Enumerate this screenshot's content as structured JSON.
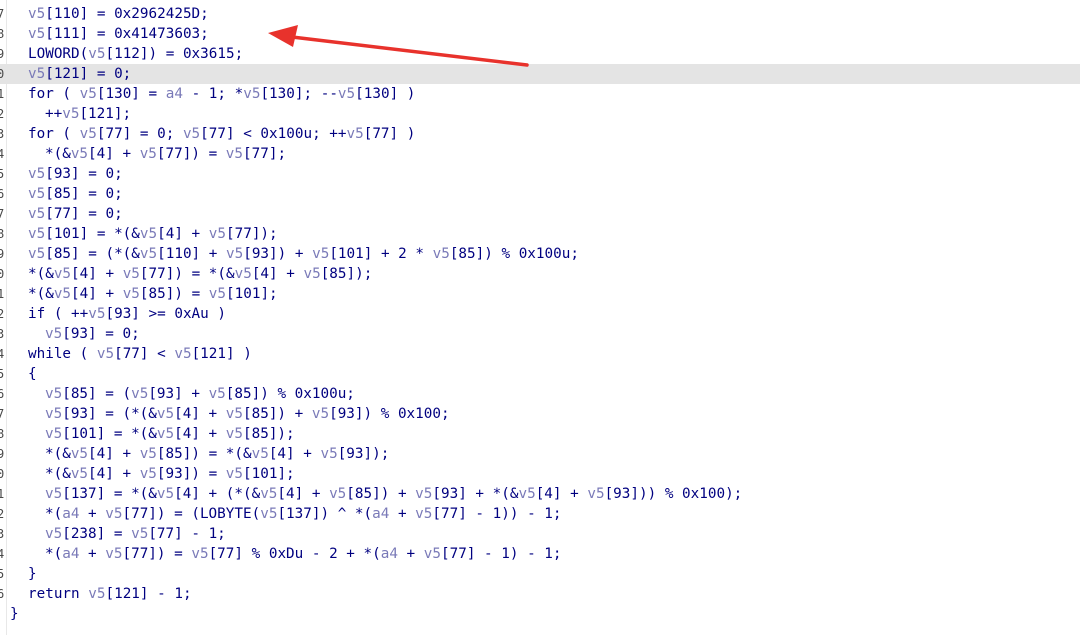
{
  "editor": {
    "gutter_numbers": [
      "7",
      "8",
      "9",
      "0",
      "1",
      "2",
      "3",
      "4",
      "5",
      "6",
      "7",
      "8",
      "9",
      "0",
      "1",
      "2",
      "3",
      "4",
      "5",
      "6",
      "7",
      "8",
      "9",
      "0",
      "1",
      "2",
      "3",
      "4",
      "5",
      "6"
    ],
    "lines": [
      {
        "indent": 1,
        "text": "v5[110] = 0x2962425D;"
      },
      {
        "indent": 1,
        "text": "v5[111] = 0x41473603;"
      },
      {
        "indent": 1,
        "text": "LOWORD(v5[112]) = 0x3615;"
      },
      {
        "indent": 1,
        "text": "v5[121] = 0;",
        "highlighted": true
      },
      {
        "indent": 1,
        "text": "for ( v5[130] = a4 - 1; *v5[130]; --v5[130] )"
      },
      {
        "indent": 2,
        "text": "++v5[121];"
      },
      {
        "indent": 1,
        "text": "for ( v5[77] = 0; v5[77] < 0x100u; ++v5[77] )"
      },
      {
        "indent": 2,
        "text": "*(&v5[4] + v5[77]) = v5[77];"
      },
      {
        "indent": 1,
        "text": "v5[93] = 0;"
      },
      {
        "indent": 1,
        "text": "v5[85] = 0;"
      },
      {
        "indent": 1,
        "text": "v5[77] = 0;"
      },
      {
        "indent": 1,
        "text": "v5[101] = *(&v5[4] + v5[77]);"
      },
      {
        "indent": 1,
        "text": "v5[85] = (*(&v5[110] + v5[93]) + v5[101] + 2 * v5[85]) % 0x100u;"
      },
      {
        "indent": 1,
        "text": "*(&v5[4] + v5[77]) = *(&v5[4] + v5[85]);"
      },
      {
        "indent": 1,
        "text": "*(&v5[4] + v5[85]) = v5[101];"
      },
      {
        "indent": 1,
        "text": "if ( ++v5[93] >= 0xAu )"
      },
      {
        "indent": 2,
        "text": "v5[93] = 0;"
      },
      {
        "indent": 1,
        "text": "while ( v5[77] < v5[121] )"
      },
      {
        "indent": 1,
        "text": "{"
      },
      {
        "indent": 2,
        "text": "v5[85] = (v5[93] + v5[85]) % 0x100u;"
      },
      {
        "indent": 2,
        "text": "v5[93] = (*(&v5[4] + v5[85]) + v5[93]) % 0x100;"
      },
      {
        "indent": 2,
        "text": "v5[101] = *(&v5[4] + v5[85]);"
      },
      {
        "indent": 2,
        "text": "*(&v5[4] + v5[85]) = *(&v5[4] + v5[93]);"
      },
      {
        "indent": 2,
        "text": "*(&v5[4] + v5[93]) = v5[101];"
      },
      {
        "indent": 2,
        "text": "v5[137] = *(&v5[4] + (*(&v5[4] + v5[85]) + v5[93] + *(&v5[4] + v5[93])) % 0x100);"
      },
      {
        "indent": 2,
        "text": "*(a4 + v5[77]) = (LOBYTE(v5[137]) ^ *(a4 + v5[77] - 1)) - 1;"
      },
      {
        "indent": 2,
        "text": "v5[238] = v5[77] - 1;"
      },
      {
        "indent": 2,
        "text": "*(a4 + v5[77]) = v5[77] % 0xDu - 2 + *(a4 + v5[77] - 1) - 1;"
      },
      {
        "indent": 1,
        "text": "}"
      },
      {
        "indent": 1,
        "text": "return v5[121] - 1;"
      },
      {
        "indent": 0,
        "text": "}"
      }
    ]
  },
  "annotation": {
    "arrow_color": "#e8322c"
  }
}
